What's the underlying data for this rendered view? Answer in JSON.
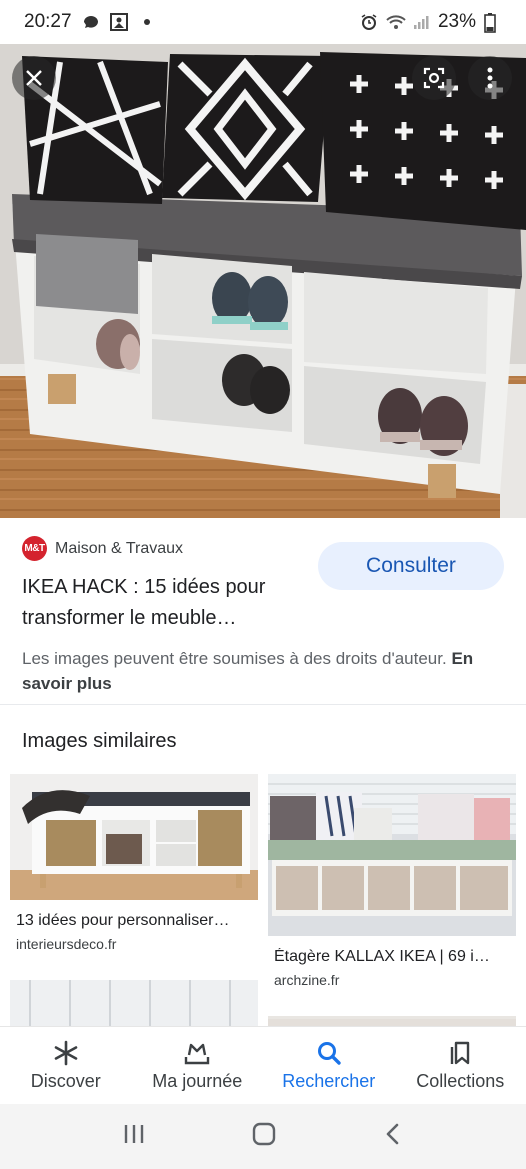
{
  "status_bar": {
    "time": "20:27",
    "battery": "23%",
    "icons": [
      "notification-icon",
      "gallery-icon",
      "dot-icon",
      "alarm-icon",
      "wifi-icon",
      "signal-icon",
      "battery-icon"
    ]
  },
  "hero": {
    "close_icon": "close-icon",
    "lens_icon": "lens-icon",
    "more_icon": "more-vert-icon",
    "colors": {
      "pillow": "#1c1a1b",
      "cushion": "#5c5a5c",
      "bench": "#f5f5f3",
      "wall": "#d8d5d1",
      "floor": "#b07a45"
    }
  },
  "result": {
    "source_logo_text": "M&T",
    "source_name": "Maison & Travaux",
    "title": "IKEA HACK : 15 idées pour transformer le meuble…",
    "visit_button": "Consulter",
    "copyright_text": "Les images peuvent être soumises à des droits d'auteur.",
    "learn_more": "En savoir plus"
  },
  "similar": {
    "heading": "Images similaires",
    "cards": [
      {
        "title": "13 idées pour personnaliser…",
        "source": "interieursdeco.fr"
      },
      {
        "title": "Étagère KALLAX IKEA | 69 i…",
        "source": "archzine.fr"
      }
    ]
  },
  "bottom_nav": {
    "items": [
      {
        "label": "Discover",
        "icon": "asterisk-icon",
        "active": false
      },
      {
        "label": "Ma journée",
        "icon": "crown-tray-icon",
        "active": false
      },
      {
        "label": "Rechercher",
        "icon": "search-icon",
        "active": true
      },
      {
        "label": "Collections",
        "icon": "bookmark-collection-icon",
        "active": false
      }
    ],
    "active_color": "#1a73e8"
  },
  "system_nav": {
    "icons": [
      "recents-icon",
      "home-icon",
      "back-icon"
    ]
  }
}
